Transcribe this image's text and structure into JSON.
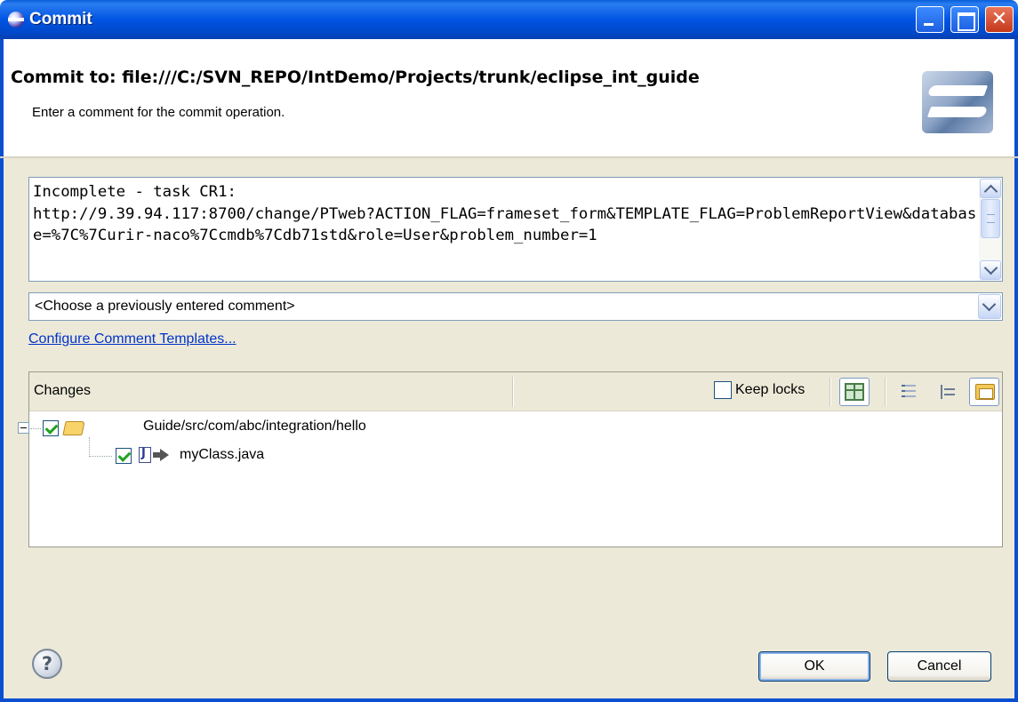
{
  "window": {
    "title": "Commit",
    "title_icon": "eclipse-icon",
    "controls": [
      "minimize",
      "maximize",
      "close"
    ],
    "close_glyph": "✕"
  },
  "header": {
    "title": "Commit to: file:///C:/SVN_REPO/IntDemo/Projects/trunk/eclipse_int_guide",
    "subtitle": "Enter a comment for the commit operation.",
    "logo_icon": "subversive-logo"
  },
  "comment": {
    "value": "Incomplete - task CR1:\nhttp://9.39.94.117:8700/change/PTweb?ACTION_FLAG=frameset_form&TEMPLATE_FLAG=ProblemReportView&database=%7C%7Curir-naco%7Ccmdb%7Cdb71std&role=User&problem_number=1"
  },
  "previous_comments": {
    "selected": "<Choose a previously entered comment>"
  },
  "configure_link": "Configure Comment Templates...",
  "changes": {
    "label": "Changes",
    "keep_locks_label": "Keep locks",
    "keep_locks_checked": false,
    "toolbar_icons": [
      "flat-layout-icon",
      "list-layout-icon",
      "tree-layout-icon",
      "folder-layout-icon"
    ],
    "tree": [
      {
        "label": "Guide/src/com/abc/integration/hello",
        "type": "folder",
        "checked": true,
        "expanded": true
      },
      {
        "label": "myClass.java",
        "type": "java-file",
        "checked": true
      }
    ]
  },
  "buttons": {
    "help_glyph": "?",
    "ok": "OK",
    "cancel": "Cancel"
  }
}
